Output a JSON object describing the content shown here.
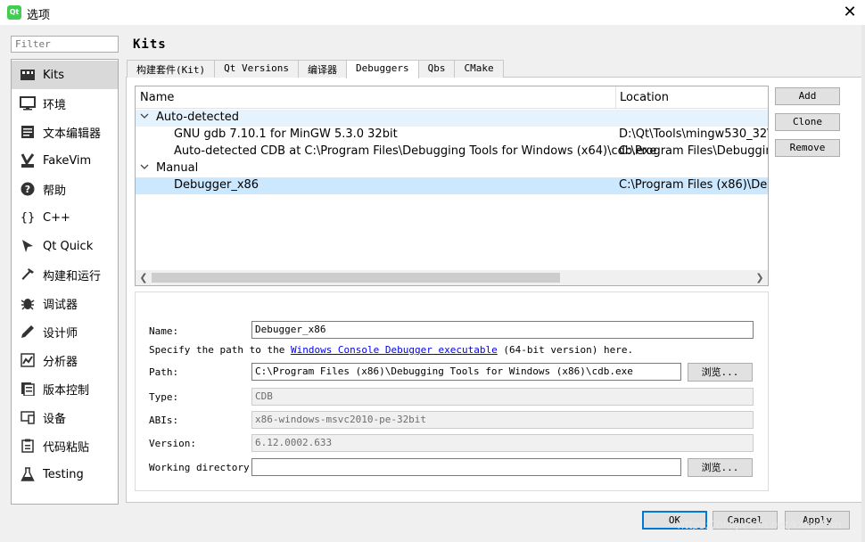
{
  "window": {
    "title": "选项",
    "app_icon": "Qt",
    "close_symbol": "✕"
  },
  "filter": {
    "placeholder": "Filter"
  },
  "sidebar": {
    "items": [
      {
        "label": "Kits",
        "icon": "kits-icon",
        "selected": true
      },
      {
        "label": "环境",
        "icon": "monitor-icon"
      },
      {
        "label": "文本编辑器",
        "icon": "text-editor-icon"
      },
      {
        "label": "FakeVim",
        "icon": "fakevim-icon"
      },
      {
        "label": "帮助",
        "icon": "help-icon"
      },
      {
        "label": "C++",
        "icon": "braces-icon"
      },
      {
        "label": "Qt Quick",
        "icon": "qt-quick-icon"
      },
      {
        "label": "构建和运行",
        "icon": "hammer-icon"
      },
      {
        "label": "调试器",
        "icon": "bug-icon"
      },
      {
        "label": "设计师",
        "icon": "pencil-icon"
      },
      {
        "label": "分析器",
        "icon": "analyzer-icon"
      },
      {
        "label": "版本控制",
        "icon": "version-control-icon"
      },
      {
        "label": "设备",
        "icon": "device-icon"
      },
      {
        "label": "代码粘贴",
        "icon": "paste-icon"
      },
      {
        "label": "Testing",
        "icon": "flask-icon"
      }
    ]
  },
  "page": {
    "heading": "Kits"
  },
  "tabs": [
    {
      "label": "构建套件(Kit)"
    },
    {
      "label": "Qt Versions"
    },
    {
      "label": "编译器"
    },
    {
      "label": "Debuggers",
      "active": true
    },
    {
      "label": "Qbs"
    },
    {
      "label": "CMake"
    }
  ],
  "tree": {
    "columns": {
      "name": "Name",
      "location": "Location"
    },
    "groups": [
      {
        "label": "Auto-detected",
        "rows": [
          {
            "name": "GNU gdb 7.10.1 for MinGW 5.3.0 32bit",
            "location": "D:\\Qt\\Tools\\mingw530_32\\bi"
          },
          {
            "name": "Auto-detected CDB at C:\\Program Files\\Debugging Tools for Windows (x64)\\cdb.exe",
            "location": "C:\\Program Files\\Debugging"
          }
        ]
      },
      {
        "label": "Manual",
        "rows": [
          {
            "name": "Debugger_x86",
            "location": "C:\\Program Files (x86)\\Debug",
            "selected": true
          }
        ]
      }
    ]
  },
  "buttons": {
    "add": "Add",
    "clone": "Clone",
    "remove": "Remove"
  },
  "details": {
    "name_label": "Name:",
    "name_value": "Debugger_x86",
    "hint_prefix": "Specify the path to the ",
    "hint_link": "Windows Console Debugger executable",
    "hint_suffix": " (64-bit version) here.",
    "path_label": "Path:",
    "path_value": "C:\\Program Files (x86)\\Debugging Tools for Windows (x86)\\cdb.exe",
    "browse_label": "浏览...",
    "type_label": "Type:",
    "type_value": "CDB",
    "abis_label": "ABIs:",
    "abis_value": "x86-windows-msvc2010-pe-32bit",
    "version_label": "Version:",
    "version_value": "6.12.0002.633",
    "workdir_label": "Working directory:",
    "workdir_value": ""
  },
  "footer": {
    "ok": "OK",
    "cancel": "Cancel",
    "apply": "Apply",
    "watermark": "https://blog.csdn.net/kakaihun"
  }
}
